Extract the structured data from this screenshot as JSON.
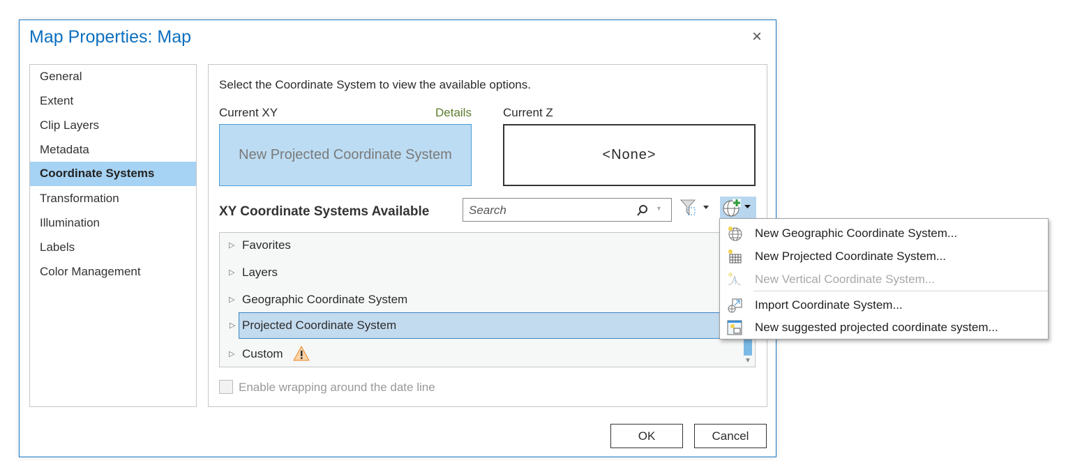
{
  "dialog": {
    "title": "Map Properties: Map",
    "close": "×"
  },
  "nav": {
    "items": [
      "General",
      "Extent",
      "Clip Layers",
      "Metadata",
      "Coordinate Systems",
      "Transformation",
      "Illumination",
      "Labels",
      "Color Management"
    ],
    "selected": "Coordinate Systems"
  },
  "panel": {
    "instruction": "Select the Coordinate System to view the available options.",
    "current_xy_label": "Current XY",
    "details_link": "Details",
    "current_xy_value": "New Projected Coordinate System",
    "current_z_label": "Current Z",
    "current_z_value": "<None>",
    "available_heading": "XY Coordinate Systems Available",
    "search_placeholder": "Search",
    "tree": [
      "Favorites",
      "Layers",
      "Geographic Coordinate System",
      "Projected Coordinate System",
      "Custom"
    ],
    "selected_tree": "Projected Coordinate System",
    "wrap_checkbox": "Enable wrapping around the date line",
    "wrap_checked": false
  },
  "menu": {
    "items": [
      {
        "label": "New Geographic Coordinate System...",
        "icon": "new-geographic-globe-icon",
        "enabled": true
      },
      {
        "label": "New Projected Coordinate System...",
        "icon": "new-projected-grid-icon",
        "enabled": true
      },
      {
        "label": "New Vertical Coordinate System...",
        "icon": "new-vertical-icon",
        "enabled": false
      },
      {
        "label": "Import Coordinate System...",
        "icon": "import-icon",
        "enabled": true
      },
      {
        "label": "New suggested projected coordinate system...",
        "icon": "suggested-projected-icon",
        "enabled": true
      }
    ]
  },
  "buttons": {
    "ok": "OK",
    "cancel": "Cancel"
  },
  "colors": {
    "accent": "#0c6fbf",
    "selected": "#a6d3f3",
    "details": "#5b7d2b"
  }
}
